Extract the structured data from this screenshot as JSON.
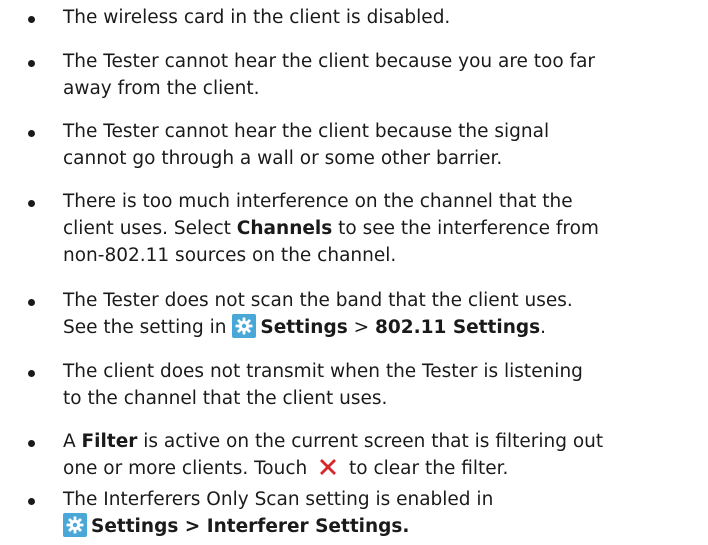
{
  "items": [
    {
      "line1": "The wireless card in the client is disabled."
    },
    {
      "line1": "The Tester cannot hear the client because you are too far",
      "line2": "away from the client."
    },
    {
      "line1": "The Tester cannot hear the client because the signal",
      "line2": "cannot go through a wall or some other barrier."
    },
    {
      "line1": "There is too much interference on the channel that the",
      "line2_pre": "client uses. Select ",
      "line2_bold": "Channels",
      "line2_post": " to see the interference from",
      "line3": "non-802.11 sources on the channel."
    },
    {
      "line1": "The Tester does not scan the band that the client uses.",
      "line2_pre": "See the setting in ",
      "line2_bold1": "Settings",
      "line2_sep": " > ",
      "line2_bold2": "802.11 Settings",
      "line2_post": "."
    },
    {
      "line1": "The client does not transmit when the Tester is listening",
      "line2": "to the channel that the client uses."
    },
    {
      "line1_pre": "A ",
      "line1_bold": "Filter",
      "line1_post": " is active on the current screen that is filtering out",
      "line2_pre": "one or more clients. Touch ",
      "line2_post": " to clear the filter."
    },
    {
      "line1": "The Interferers Only Scan setting is enabled in",
      "line2_bold": "Settings > Interferer Settings."
    }
  ],
  "colors": {
    "gear_bg": "#4aa8d8",
    "x_icon": "#d7262c"
  },
  "icons": {
    "settings": "gear-icon",
    "clear_filter": "clear-filter-x-icon"
  }
}
